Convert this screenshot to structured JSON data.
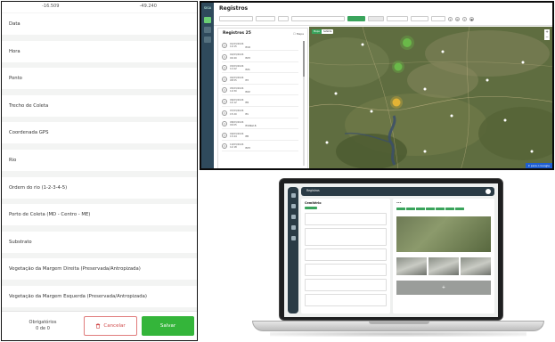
{
  "form": {
    "coord_left": "-16.509",
    "coord_right": "-49.240",
    "fields": [
      "Data",
      "Hora",
      "Ponto",
      "Trecho de Coleta",
      "Coordenada GPS",
      "Rio",
      "Ordem do rio (1-2-3-4-5)",
      "Porto de Coleta (MD - Centro - ME)",
      "Substrato",
      "Vegetação da Margem Direita (Preservada/Antropizada)",
      "Vegetação da Margem Esquerda (Preservada/Antropizada)"
    ],
    "obligatory_label": "Obrigatórios",
    "obligatory_count": "0 de 0",
    "cancel_label": "Cancelar",
    "save_label": "Salvar"
  },
  "map_window": {
    "title": "Registros",
    "logo": "SIGA",
    "panel_title": "Registros 25",
    "toggle_label": "Mapa",
    "map_mode_on": "Mapa",
    "map_mode_off": "Satélite",
    "map_link": "Ir para o Google",
    "records": [
      {
        "date": "01/03/2024",
        "time": "10:15",
        "code": "P19"
      },
      {
        "date": "02/03/2024",
        "time": "09:40",
        "code": "P23"
      },
      {
        "date": "03/03/2024",
        "time": "11:02",
        "code": "P21"
      },
      {
        "date": "04/03/2024",
        "time": "08:55",
        "code": "P3"
      },
      {
        "date": "05/03/2024",
        "time": "10:30",
        "code": "P22"
      },
      {
        "date": "06/03/2024",
        "time": "14:12",
        "code": "P9"
      },
      {
        "date": "07/03/2024",
        "time": "15:20",
        "code": "P1"
      },
      {
        "date": "08/03/2024",
        "time": "09:05",
        "code": "P10kel-6"
      },
      {
        "date": "09/03/2024",
        "time": "13:44",
        "code": "P8"
      },
      {
        "date": "10/03/2024",
        "time": "12:18",
        "code": "P23"
      }
    ]
  },
  "laptop": {
    "title": "Registros",
    "record_title": "Cemitério"
  },
  "colors": {
    "accent_green": "#34b53a",
    "cancel_red": "#d04a4a",
    "sidebar_dark": "#2f4a5c",
    "map_link_blue": "#1f5fd1"
  },
  "icons": [
    "trash-icon",
    "record-icon",
    "layers-icon",
    "user-icon"
  ]
}
